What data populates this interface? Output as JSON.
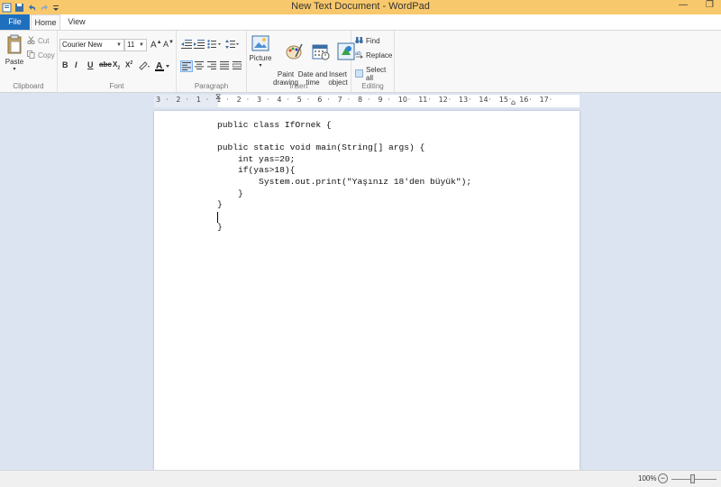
{
  "window": {
    "title": "New Text Document - WordPad",
    "minimize": "—",
    "restore": "❐"
  },
  "tabs": {
    "file": "File",
    "home": "Home",
    "view": "View"
  },
  "ribbon": {
    "clipboard": {
      "label": "Clipboard",
      "paste": "Paste",
      "cut": "Cut",
      "copy": "Copy"
    },
    "font": {
      "label": "Font",
      "family": "Courier New",
      "size": "11"
    },
    "paragraph": {
      "label": "Paragraph"
    },
    "insert": {
      "label": "Insert",
      "picture": "Picture",
      "paint_drawing": "Paint\ndrawing",
      "date_time": "Date and\ntime",
      "insert_object": "Insert\nobject"
    },
    "editing": {
      "label": "Editing",
      "find": "Find",
      "replace": "Replace",
      "select_all": "Select all"
    }
  },
  "ruler": {
    "ticks": [
      "3",
      "2",
      "1",
      "1",
      "2",
      "3",
      "4",
      "5",
      "6",
      "7",
      "8",
      "9",
      "10",
      "11",
      "12",
      "13",
      "14",
      "15",
      "16",
      "17"
    ]
  },
  "document": {
    "text": "public class IfOrnek {\n\npublic static void main(String[] args) {\n    int yas=20;\n    if(yas>18){\n        System.out.print(\"Yaşınız 18'den büyük\");\n    }\n}\n\n}"
  },
  "status": {
    "zoom": "100%"
  },
  "colors": {
    "titlebar": "#f8c86c",
    "file_tab": "#1f6fbf",
    "workspace": "#dbe4f0"
  }
}
